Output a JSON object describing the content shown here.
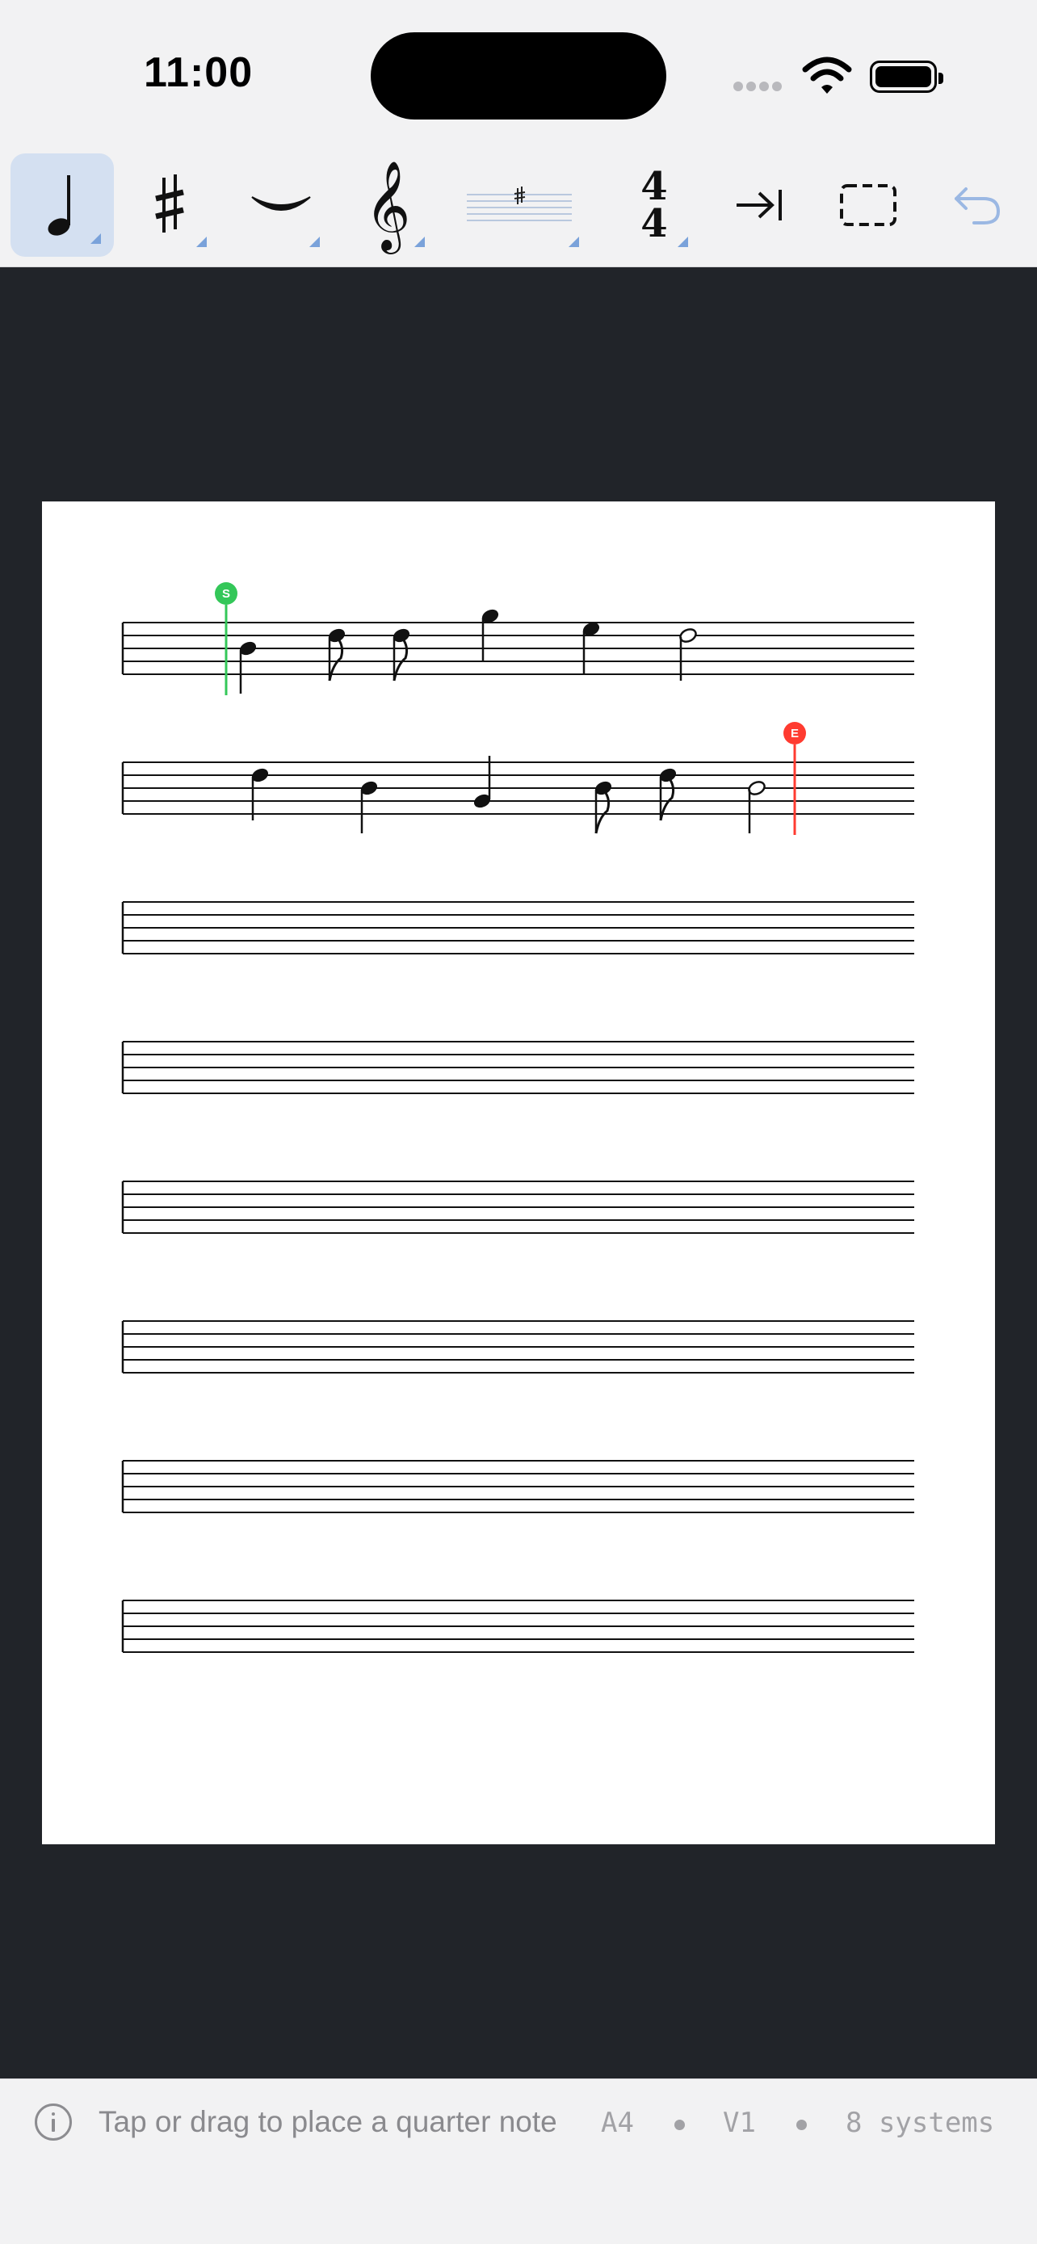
{
  "status_bar": {
    "time": "11:00"
  },
  "toolbar": {
    "tools": [
      {
        "id": "note",
        "icon": "quarter-note-icon",
        "selected": true,
        "has_menu": true
      },
      {
        "id": "accidental",
        "icon": "sharp-icon",
        "selected": false,
        "has_menu": true
      },
      {
        "id": "slur",
        "icon": "slur-icon",
        "selected": false,
        "has_menu": true
      },
      {
        "id": "clef",
        "icon": "treble-clef-icon",
        "selected": false,
        "has_menu": true
      },
      {
        "id": "key-signature",
        "icon": "key-signature-icon",
        "selected": false,
        "has_menu": true
      },
      {
        "id": "time-signature",
        "icon": "time-signature-icon",
        "top": "4",
        "bottom": "4",
        "selected": false,
        "has_menu": true
      },
      {
        "id": "advance",
        "icon": "arrow-to-bar-icon",
        "selected": false,
        "has_menu": false
      },
      {
        "id": "select",
        "icon": "dashed-selection-icon",
        "selected": false,
        "has_menu": false
      },
      {
        "id": "undo",
        "icon": "undo-icon",
        "selected": false,
        "has_menu": false
      }
    ]
  },
  "score": {
    "start_marker": "S",
    "end_marker": "E",
    "colors": {
      "start": "#34c759",
      "end": "#ff3b30",
      "accent": "#d4e0f1"
    },
    "system_count": 8,
    "systems": [
      {
        "notes": [
          {
            "type": "quarter",
            "step": 4,
            "stem": "down"
          },
          {
            "type": "eighth",
            "step": 6,
            "stem": "down"
          },
          {
            "type": "eighth",
            "step": 6,
            "stem": "down"
          },
          {
            "type": "quarter",
            "step": 9,
            "stem": "down"
          },
          {
            "type": "quarter",
            "step": 7,
            "stem": "down"
          },
          {
            "type": "half",
            "step": 6,
            "stem": "down"
          }
        ]
      },
      {
        "notes": [
          {
            "type": "quarter",
            "step": 6,
            "stem": "down"
          },
          {
            "type": "quarter",
            "step": 4,
            "stem": "down"
          },
          {
            "type": "quarter",
            "step": 2,
            "stem": "up"
          },
          {
            "type": "eighth",
            "step": 4,
            "stem": "down"
          },
          {
            "type": "eighth",
            "step": 6,
            "stem": "down"
          },
          {
            "type": "half",
            "step": 4,
            "stem": "down"
          }
        ]
      },
      {
        "notes": []
      },
      {
        "notes": []
      },
      {
        "notes": []
      },
      {
        "notes": []
      },
      {
        "notes": []
      },
      {
        "notes": []
      }
    ]
  },
  "bottom_bar": {
    "hint": "Tap or drag to place a quarter note",
    "paper": "A4",
    "voice": "V1",
    "systems_label": "8 systems"
  }
}
